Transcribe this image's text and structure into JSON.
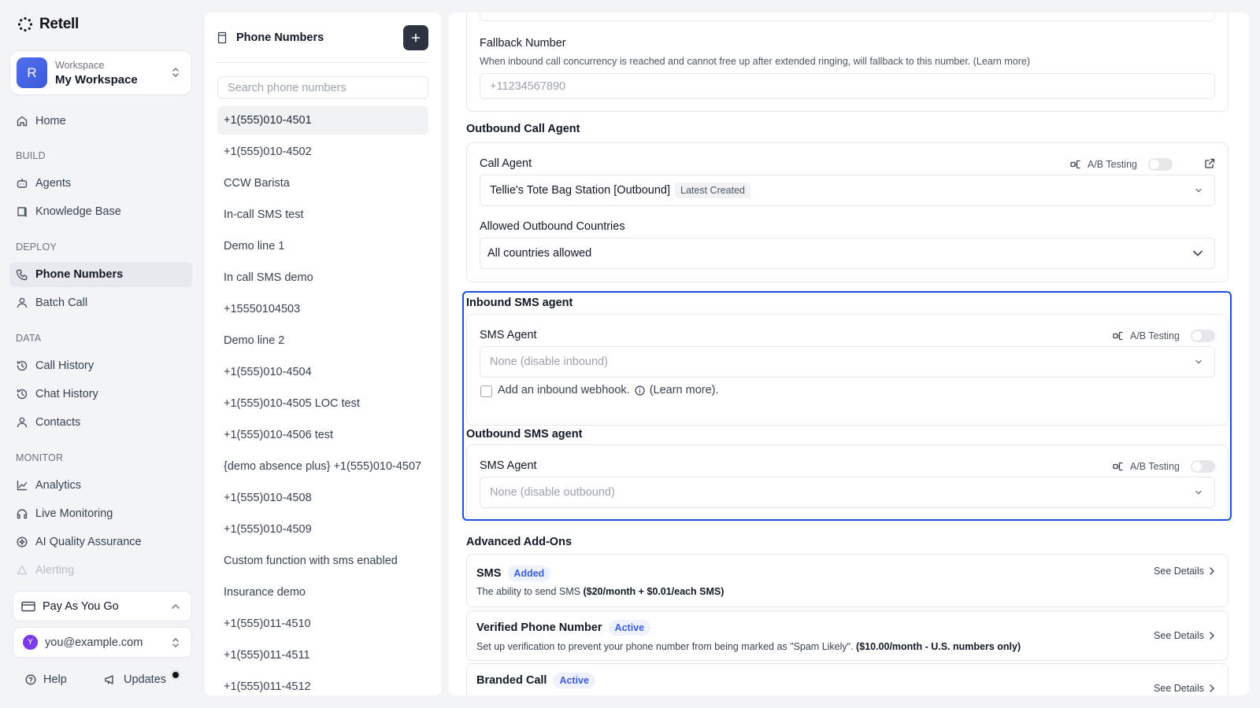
{
  "app": {
    "name": "Retell"
  },
  "workspace": {
    "label": "Workspace",
    "name": "My Workspace",
    "initial": "R"
  },
  "nav": {
    "home": "Home",
    "build_label": "BUILD",
    "agents": "Agents",
    "knowledge_base": "Knowledge Base",
    "deploy_label": "DEPLOY",
    "phone_numbers": "Phone Numbers",
    "batch_call": "Batch Call",
    "data_label": "DATA",
    "call_history": "Call History",
    "chat_history": "Chat History",
    "contacts": "Contacts",
    "monitor_label": "MONITOR",
    "analytics": "Analytics",
    "live_monitoring": "Live Monitoring",
    "ai_qa": "AI Quality Assurance",
    "alerting": "Alerting"
  },
  "plan": {
    "label": "Pay As You Go"
  },
  "account": {
    "email": "you@example.com",
    "initial": "Y"
  },
  "footer": {
    "help": "Help",
    "updates": "Updates"
  },
  "phone_panel": {
    "title": "Phone Numbers",
    "search_placeholder": "Search phone numbers",
    "items": [
      "+1(555)010-4501",
      "+1(555)010-4502",
      "CCW Barista",
      "In-call SMS test",
      "Demo line 1",
      "In call SMS demo",
      "+15550104503",
      "Demo line 2",
      "+1(555)010-4504",
      "+1(555)010-4505 LOC test",
      "+1(555)010-4506 test",
      "{demo absence plus} +1(555)010-4507",
      "+1(555)010-4508",
      "+1(555)010-4509",
      "Custom function with sms enabled",
      "Insurance demo",
      "+1(555)011-4510",
      "+1(555)011-4511",
      "+1(555)011-4512"
    ]
  },
  "fallback": {
    "label": "Fallback Number",
    "help": "When inbound call concurrency is reached and cannot free up after extended ringing, will fallback to this number. (Learn more)",
    "placeholder": "+11234567890"
  },
  "outbound_call": {
    "section_title": "Outbound Call Agent",
    "call_agent_label": "Call Agent",
    "ab_label": "A/B Testing",
    "agent_value": "Tellie's Tote Bag Station [Outbound]",
    "agent_tag": "Latest Created",
    "countries_label": "Allowed Outbound Countries",
    "countries_value": "All countries allowed"
  },
  "inbound_sms": {
    "section_title": "Inbound SMS agent",
    "agent_label": "SMS Agent",
    "ab_label": "A/B Testing",
    "placeholder": "None (disable inbound)",
    "webhook_text": "Add an inbound webhook.",
    "learn_more": "(Learn more)."
  },
  "outbound_sms": {
    "section_title": "Outbound SMS agent",
    "agent_label": "SMS Agent",
    "ab_label": "A/B Testing",
    "placeholder": "None (disable outbound)"
  },
  "addons": {
    "section_title": "Advanced Add-Ons",
    "see_details": "See Details",
    "sms": {
      "name": "SMS",
      "badge": "Added",
      "desc": "The ability to send SMS ",
      "price": "($20/month + $0.01/each SMS)"
    },
    "verified": {
      "name": "Verified Phone Number",
      "badge": "Active",
      "desc": "Set up verification to prevent your phone number from being marked as \"Spam Likely\". ",
      "price": "($10.00/month - U.S. numbers only)"
    },
    "branded": {
      "name": "Branded Call",
      "badge": "Active"
    }
  },
  "colors": {
    "accent": "#1d4ed8",
    "badge_text": "#3b5bdb",
    "badge_bg": "#eef2ff",
    "dark_button": "#2d3340"
  }
}
